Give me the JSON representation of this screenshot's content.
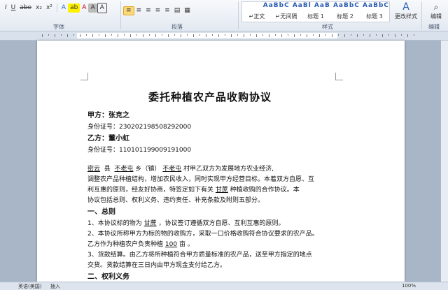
{
  "ribbon": {
    "font_row": [
      "I",
      "U",
      "abe",
      "x₂",
      "x²",
      "A",
      "ab",
      "A",
      "A",
      "A"
    ],
    "para_row": [
      "≡",
      "≡",
      "≡",
      "≡",
      "≡",
      "▤",
      "▦"
    ],
    "styles": [
      "↵正文",
      "↵无间隔",
      "标题 1",
      "标题 2",
      "标题 3"
    ],
    "style_preview": "AaBbC AaBl AaB AaBbC AaBbC",
    "change_styles": "更改样式",
    "edit": "编辑",
    "groups": [
      "字体",
      "段落",
      "样式",
      "编辑"
    ]
  },
  "doc": {
    "title": "委托种植农产品收购协议",
    "party_a": "甲方：张克之",
    "id_a": "身份证号：230202198508292000",
    "party_b": "乙方：董小虹",
    "id_b": "身份证号：110101199009191000",
    "intro_1_a": "密云",
    "intro_1_b": "县",
    "intro_1_c": "不老屯",
    "intro_1_d": "乡（镇）",
    "intro_1_e": "不老屯",
    "intro_1_f": "村甲乙双方为发展地方农业经济,",
    "intro_2": "调整农产品种植结构，增加农民收入，同时实现甲方经营目标。本着双方自愿、互",
    "intro_3_a": "利互惠的原则，经友好协商，特签定如下有关",
    "intro_3_b": "甘蔗",
    "intro_3_c": "种植收购的合作协议。本",
    "intro_4": "协议包括总则、权利义务、违约责任、补充条款及附则五部分。",
    "sec1": "一、总则",
    "c1_a": "1、本协议标的物为",
    "c1_b": "甘蔗",
    "c1_c": "，协议签订遵循双方自愿、互利互惠的原则。",
    "c2_a": "2、本协议所称甲方为标的物的收购方，采取一口价格收购符合协议要求的农产品。",
    "c2_b": "乙方作为种植农户负责种植",
    "c2_c": "100",
    "c2_d": "亩 。",
    "c3_a": "3、货款结算。由乙方将所种植符合甲方质量标准的农产品，送至甲方指定的地点",
    "c3_b": "交货。货款结算在三日内由甲方现金支付给乙方。",
    "sec2": "二、权利义务"
  },
  "status": {
    "language": "英语(美国)",
    "mode": "插入",
    "zoom": "100%"
  }
}
